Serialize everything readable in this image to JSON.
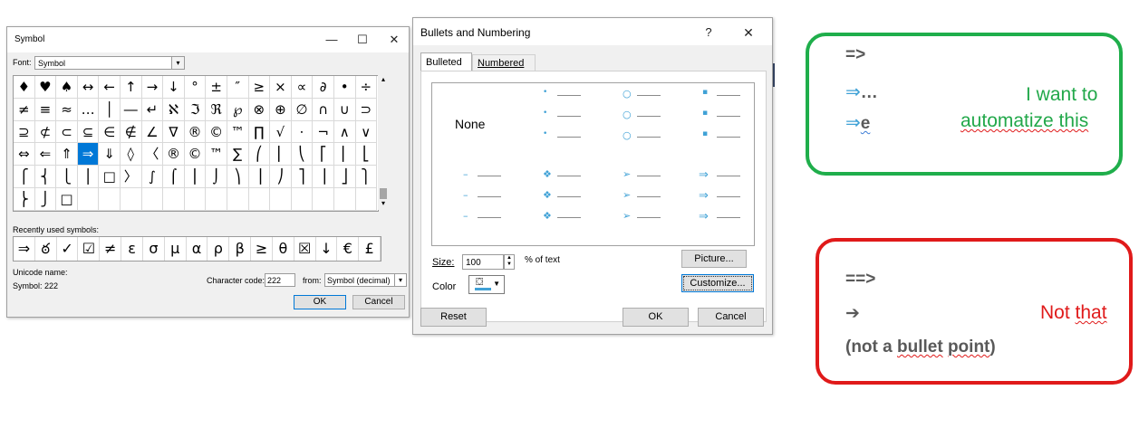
{
  "symbol_dialog": {
    "title": "Symbol",
    "font_label": "Font:",
    "font_value": "Symbol",
    "grid_rows": [
      [
        "♦",
        "♥",
        "♠",
        "↔",
        "←",
        "↑",
        "→",
        "↓",
        "°",
        "±",
        "″",
        "≥",
        "×",
        "∝",
        "∂",
        "•",
        "÷"
      ],
      [
        "≠",
        "≡",
        "≈",
        "…",
        "│",
        "―",
        "↵",
        "ℵ",
        "ℑ",
        "ℜ",
        "℘",
        "⊗",
        "⊕",
        "∅",
        "∩",
        "∪",
        "⊃"
      ],
      [
        "⊇",
        "⊄",
        "⊂",
        "⊆",
        "∈",
        "∉",
        "∠",
        "∇",
        "®",
        "©",
        "™",
        "∏",
        "√",
        "⋅",
        "¬",
        "∧",
        "∨"
      ],
      [
        "⇔",
        "⇐",
        "⇑",
        "⇒",
        "⇓",
        "◊",
        "〈",
        "®",
        "©",
        "™",
        "∑",
        "⎛",
        "⎜",
        "⎝",
        "⎡",
        "⎢",
        "⎣"
      ],
      [
        "⎧",
        "⎨",
        "⎩",
        "⎪",
        "□",
        "〉",
        "∫",
        "⌠",
        "⎮",
        "⌡",
        "⎞",
        "⎟",
        "⎠",
        "⎤",
        "⎥",
        "⎦",
        "⎫"
      ],
      [
        "⎬",
        "⎭",
        "□",
        "",
        "",
        "",
        "",
        "",
        "",
        "",
        "",
        "",
        "",
        "",
        "",
        "",
        ""
      ]
    ],
    "selected_symbol": "⇒",
    "recent_label": "Recently used symbols:",
    "recent_symbols": [
      "⇒",
      "ఠ",
      "✓",
      "☑",
      "≠",
      "ε",
      "σ",
      "μ",
      "α",
      "ρ",
      "β",
      "≥",
      "θ",
      "☒",
      "↓",
      "€",
      "£"
    ],
    "unicode_name_label": "Unicode name:",
    "unicode_name_value": "Symbol: 222",
    "char_code_label": "Character code:",
    "char_code_value": "222",
    "from_label": "from:",
    "from_value": "Symbol (decimal)",
    "ok": "OK",
    "cancel": "Cancel"
  },
  "bullets_dialog": {
    "title": "Bullets and Numbering",
    "help": "?",
    "close": "✕",
    "tabs": [
      "Bulleted",
      "Numbered"
    ],
    "none_label": "None",
    "gallery": [
      {
        "glyph": ""
      },
      {
        "glyph": "•"
      },
      {
        "glyph": "○"
      },
      {
        "glyph": "▪"
      },
      {
        "glyph": "–"
      },
      {
        "glyph": "❖"
      },
      {
        "glyph": "➢"
      },
      {
        "glyph": "⇒"
      }
    ],
    "size_label": "Size:",
    "size_value": "100",
    "pct_label": "% of text",
    "color_label": "Color",
    "picture": "Picture...",
    "customize": "Customize...",
    "reset": "Reset",
    "ok": "OK",
    "cancel": "Cancel"
  },
  "green_note": {
    "line1": "=>",
    "arrow": "⇒",
    "line2_text": "…",
    "line3_text": "e",
    "caption_1": "I want to",
    "caption_2": "automatize this",
    "color": "#1fae4b"
  },
  "red_note": {
    "line1": "==>",
    "line2": "➔",
    "line3": "(not a bullet point)",
    "caption": "Not that",
    "color": "#e01a1a"
  }
}
